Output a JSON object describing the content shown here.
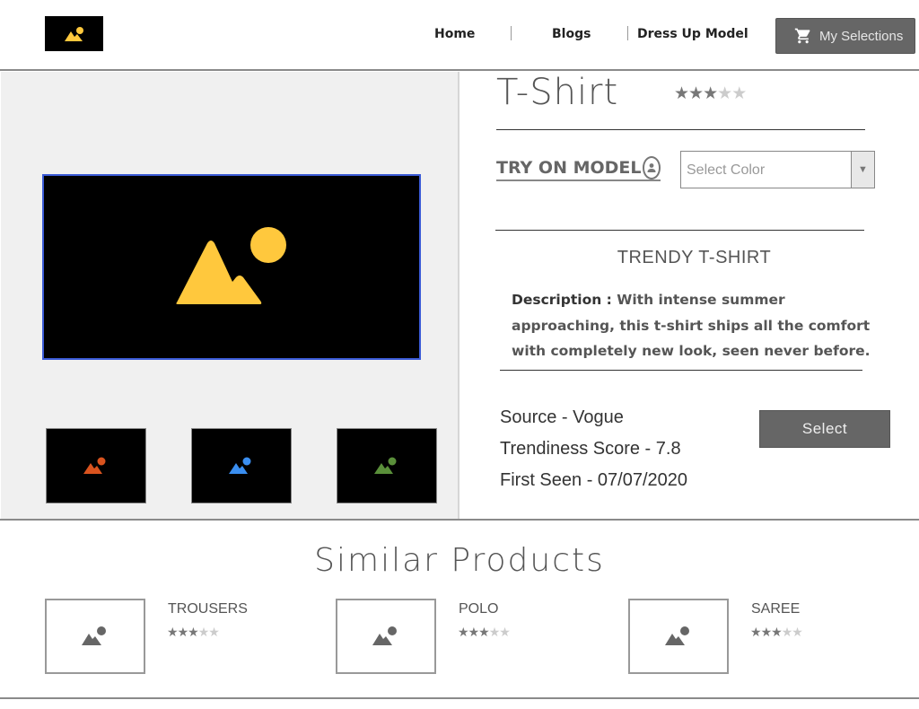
{
  "header": {
    "logo_icon": "image-placeholder-icon",
    "nav": [
      "Home",
      "Blogs",
      "Dress Up Model"
    ],
    "cart_icon": "shopping-cart-icon",
    "my_selections_label": "My Selections"
  },
  "product": {
    "title": "T-Shirt",
    "rating": 3,
    "rating_max": 5,
    "try_on_label": "TRY ON MODEL",
    "try_on_icon": "person-icon",
    "color_placeholder": "Select Color",
    "subtitle": "TRENDY T-SHIRT",
    "description_label": "Description :",
    "description_text": "With intense summer approaching, this t-shirt ships all the comfort with completely new look, seen never before.",
    "source": "Source -  Vogue",
    "trendiness": "Trendiness Score - 7.8",
    "first_seen": "First Seen - 07/07/2020",
    "select_label": "Select"
  },
  "gallery": {
    "main_color": "#ffc83d",
    "thumb_colors": [
      "#d9531e",
      "#3a8ef0",
      "#5a8f3a"
    ]
  },
  "similar": {
    "title": "Similar Products",
    "items": [
      {
        "name": "TROUSERS",
        "rating": 3
      },
      {
        "name": "POLO",
        "rating": 3
      },
      {
        "name": "SAREE",
        "rating": 3
      }
    ]
  },
  "colors": {
    "accent_border": "#3b5bd6",
    "button_bg": "#666666",
    "star_on": "#777777",
    "star_off": "#cccccc"
  }
}
